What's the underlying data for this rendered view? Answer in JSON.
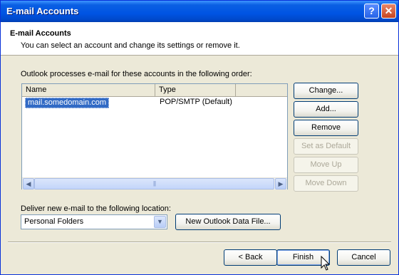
{
  "window": {
    "title": "E-mail Accounts"
  },
  "header": {
    "title": "E-mail Accounts",
    "subtitle": "You can select an account and change its settings or remove it.",
    "icon": "mailbox-icon"
  },
  "accounts": {
    "prompt": "Outlook processes e-mail for these accounts in the following order:",
    "columns": [
      "Name",
      "Type"
    ],
    "rows": [
      {
        "name": "mail.somedomain.com",
        "type": "POP/SMTP (Default)"
      }
    ]
  },
  "side_buttons": [
    {
      "label": "Change...",
      "enabled": true
    },
    {
      "label": "Add...",
      "enabled": true
    },
    {
      "label": "Remove",
      "enabled": true
    },
    {
      "label": "Set as Default",
      "enabled": false
    },
    {
      "label": "Move Up",
      "enabled": false
    },
    {
      "label": "Move Down",
      "enabled": false
    }
  ],
  "deliver": {
    "label": "Deliver new e-mail to the following location:",
    "selected": "Personal Folders",
    "new_file_button": "New Outlook Data File..."
  },
  "footer": {
    "back": "< Back",
    "finish": "Finish",
    "cancel": "Cancel"
  },
  "colors": {
    "titlebar": "#0054e3",
    "selection": "#316ac5",
    "dialog_bg": "#ece9d8"
  }
}
